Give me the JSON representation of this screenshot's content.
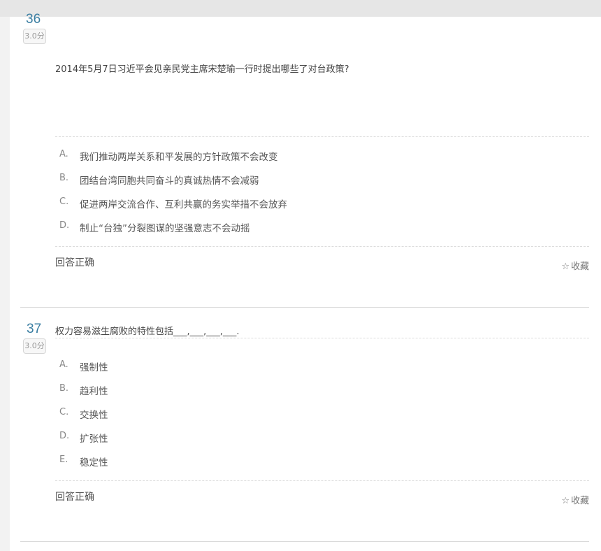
{
  "questions": [
    {
      "number": "36",
      "score": "3.0分",
      "text": "2014年5月7日习近平会见亲民党主席宋楚瑜一行时提出哪些了对台政策?",
      "options": [
        {
          "letter": "A.",
          "text": "我们推动两岸关系和平发展的方针政策不会改变"
        },
        {
          "letter": "B.",
          "text": "团结台湾同胞共同奋斗的真诚热情不会减弱"
        },
        {
          "letter": "C.",
          "text": "促进两岸交流合作、互利共赢的务实举措不会放弃"
        },
        {
          "letter": "D.",
          "text": "制止“台独”分裂图谋的坚强意志不会动摇"
        }
      ],
      "result": "回答正确",
      "favorite_label": "收藏"
    },
    {
      "number": "37",
      "score": "3.0分",
      "text": "权力容易滋生腐败的特性包括___,___,___,___.",
      "options": [
        {
          "letter": "A.",
          "text": "强制性"
        },
        {
          "letter": "B.",
          "text": "趋利性"
        },
        {
          "letter": "C.",
          "text": "交换性"
        },
        {
          "letter": "D.",
          "text": "扩张性"
        },
        {
          "letter": "E.",
          "text": "稳定性"
        }
      ],
      "result": "回答正确",
      "favorite_label": "收藏"
    }
  ],
  "icons": {
    "favorite": "star-outline-icon"
  }
}
